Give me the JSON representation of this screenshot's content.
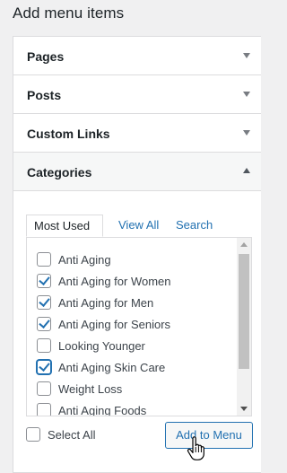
{
  "page": {
    "title": "Add menu items"
  },
  "sections": {
    "pages": "Pages",
    "posts": "Posts",
    "custom_links": "Custom Links",
    "categories": "Categories"
  },
  "tabs": {
    "most_used": "Most Used",
    "view_all": "View All",
    "search": "Search"
  },
  "categories": [
    {
      "label": "Anti Aging",
      "checked": false
    },
    {
      "label": "Anti Aging for Women",
      "checked": true
    },
    {
      "label": "Anti Aging for Men",
      "checked": true
    },
    {
      "label": "Anti Aging for Seniors",
      "checked": true
    },
    {
      "label": "Looking Younger",
      "checked": false
    },
    {
      "label": "Anti Aging Skin Care",
      "checked": true
    },
    {
      "label": "Weight Loss",
      "checked": false
    },
    {
      "label": "Anti Aging Foods",
      "checked": false
    }
  ],
  "footer": {
    "select_all": "Select All",
    "select_all_checked": false,
    "add_button": "Add to Menu"
  },
  "colors": {
    "accent": "#2271b1",
    "border": "#dcdcde",
    "background": "#f0f0f1"
  },
  "icons": {
    "expand": "triangle-down-icon",
    "collapse": "triangle-up-icon",
    "cursor": "hand-pointer-icon"
  }
}
